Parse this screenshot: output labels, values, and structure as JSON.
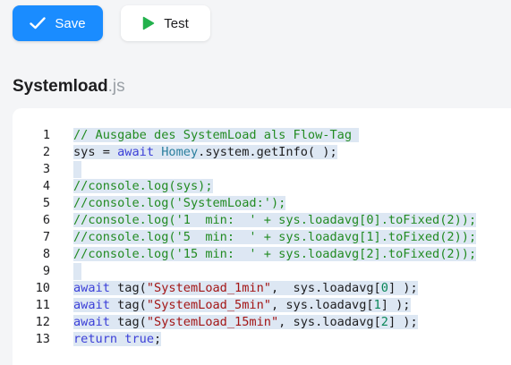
{
  "toolbar": {
    "save_label": "Save",
    "test_label": "Test",
    "accent_color": "#1a8cff",
    "test_icon_color": "#22b14c"
  },
  "file": {
    "name": "Systemload",
    "ext": ".js"
  },
  "editor": {
    "lines": [
      {
        "num": "1",
        "tokens": [
          [
            "c",
            "// Ausgabe des SystemLoad als Flow-Tag "
          ]
        ]
      },
      {
        "num": "2",
        "tokens": [
          [
            "p",
            "sys = "
          ],
          [
            "kw",
            "await"
          ],
          [
            "p",
            " "
          ],
          [
            "fn",
            "Homey"
          ],
          [
            "p",
            ".system.getInfo( );"
          ]
        ]
      },
      {
        "num": "3",
        "tokens": []
      },
      {
        "num": "4",
        "tokens": [
          [
            "c",
            "//console.log(sys);"
          ]
        ]
      },
      {
        "num": "5",
        "tokens": [
          [
            "c",
            "//console.log('SystemLoad:');"
          ]
        ]
      },
      {
        "num": "6",
        "tokens": [
          [
            "c",
            "//console.log('1  min:  ' + sys.loadavg[0].toFixed(2));"
          ]
        ]
      },
      {
        "num": "7",
        "tokens": [
          [
            "c",
            "//console.log('5  min:  ' + sys.loadavg[1].toFixed(2));"
          ]
        ]
      },
      {
        "num": "8",
        "tokens": [
          [
            "c",
            "//console.log('15 min:  ' + sys.loadavg[2].toFixed(2));"
          ]
        ]
      },
      {
        "num": "9",
        "tokens": []
      },
      {
        "num": "10",
        "tokens": [
          [
            "kw",
            "await"
          ],
          [
            "p",
            " tag("
          ],
          [
            "str",
            "\"SystemLoad_1min\""
          ],
          [
            "p",
            ",  sys.loadavg["
          ],
          [
            "num",
            "0"
          ],
          [
            "p",
            "] );"
          ]
        ]
      },
      {
        "num": "11",
        "tokens": [
          [
            "kw",
            "await"
          ],
          [
            "p",
            " tag("
          ],
          [
            "str",
            "\"SystemLoad_5min\""
          ],
          [
            "p",
            ", sys.loadavg["
          ],
          [
            "num",
            "1"
          ],
          [
            "p",
            "] );"
          ]
        ]
      },
      {
        "num": "12",
        "tokens": [
          [
            "kw",
            "await"
          ],
          [
            "p",
            " tag("
          ],
          [
            "str",
            "\"SystemLoad_15min\""
          ],
          [
            "p",
            ", sys.loadavg["
          ],
          [
            "num",
            "2"
          ],
          [
            "p",
            "] );"
          ]
        ]
      },
      {
        "num": "13",
        "tokens": [
          [
            "kw",
            "return"
          ],
          [
            "p",
            " "
          ],
          [
            "kw",
            "true"
          ],
          [
            "p",
            ";"
          ]
        ]
      }
    ]
  }
}
